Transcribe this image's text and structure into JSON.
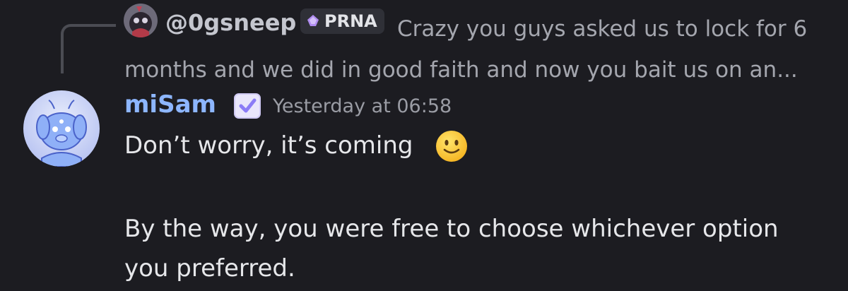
{
  "reply": {
    "author": "@0gsneep",
    "role_tag": "PRNA",
    "text_line1": "Crazy you guys asked us to lock for 6",
    "text_line2": "months and we did in good faith and now you bait us on an..."
  },
  "message": {
    "author": "miSam",
    "timestamp": "Yesterday at 06:58",
    "line1": "Don’t worry, it’s coming",
    "line2": "By the way, you were free to choose whichever option",
    "line3": "you preferred."
  },
  "colors": {
    "background": "#1c1c21",
    "author_name": "#8db6ff",
    "verified_badge": "#8b7cf6",
    "role_icon": "#b08cf0"
  },
  "icons": {
    "reply_avatar": "reply-author-avatar",
    "role": "purple-gem-icon",
    "verified": "checkmark-badge-icon",
    "emoji": "slightly-smiling-face-emoji"
  }
}
